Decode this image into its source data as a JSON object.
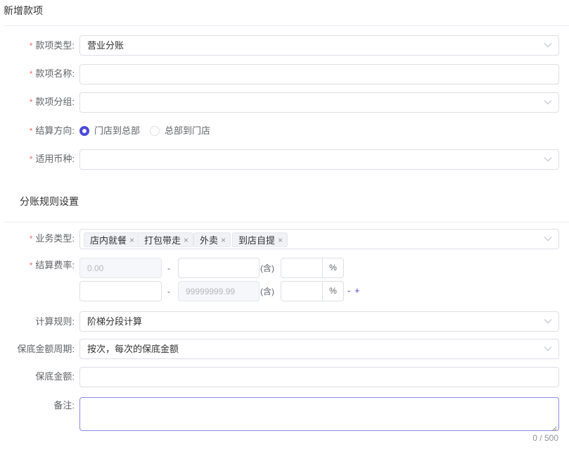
{
  "page_title": "新增款项",
  "required_mark": "*",
  "fields": {
    "type": {
      "label": "款项类型:",
      "value": "营业分账"
    },
    "name": {
      "label": "款项名称:",
      "value": ""
    },
    "group": {
      "label": "款项分组:",
      "value": ""
    },
    "direction": {
      "label": "结算方向:",
      "options": [
        "门店到总部",
        "总部到门店"
      ],
      "selected": "门店到总部"
    },
    "currency": {
      "label": "适用币种:",
      "value": ""
    }
  },
  "rules_section": {
    "title": "分账规则设置",
    "business_type": {
      "label": "业务类型:",
      "tags": [
        "店内就餐",
        "打包带走",
        "外卖",
        "到店自提"
      ],
      "tag_close": "×"
    },
    "rate": {
      "label": "结算费率:",
      "separator": "-",
      "inclusive": "(含)",
      "unit": "%",
      "row1": {
        "from_placeholder": "0.00",
        "to_value": "",
        "percent": ""
      },
      "row2": {
        "from_value": "",
        "to_placeholder": "99999999.99",
        "percent": ""
      },
      "remove_label": "-",
      "add_label": "+"
    },
    "calc_rule": {
      "label": "计算规则:",
      "value": "阶梯分段计算"
    },
    "guarantee_period": {
      "label": "保底金额周期:",
      "value": "按次，每次的保底金额"
    },
    "guarantee_amount": {
      "label": "保底金额:",
      "value": ""
    },
    "remark": {
      "label": "备注:",
      "value": "",
      "counter": "0 / 500"
    }
  }
}
